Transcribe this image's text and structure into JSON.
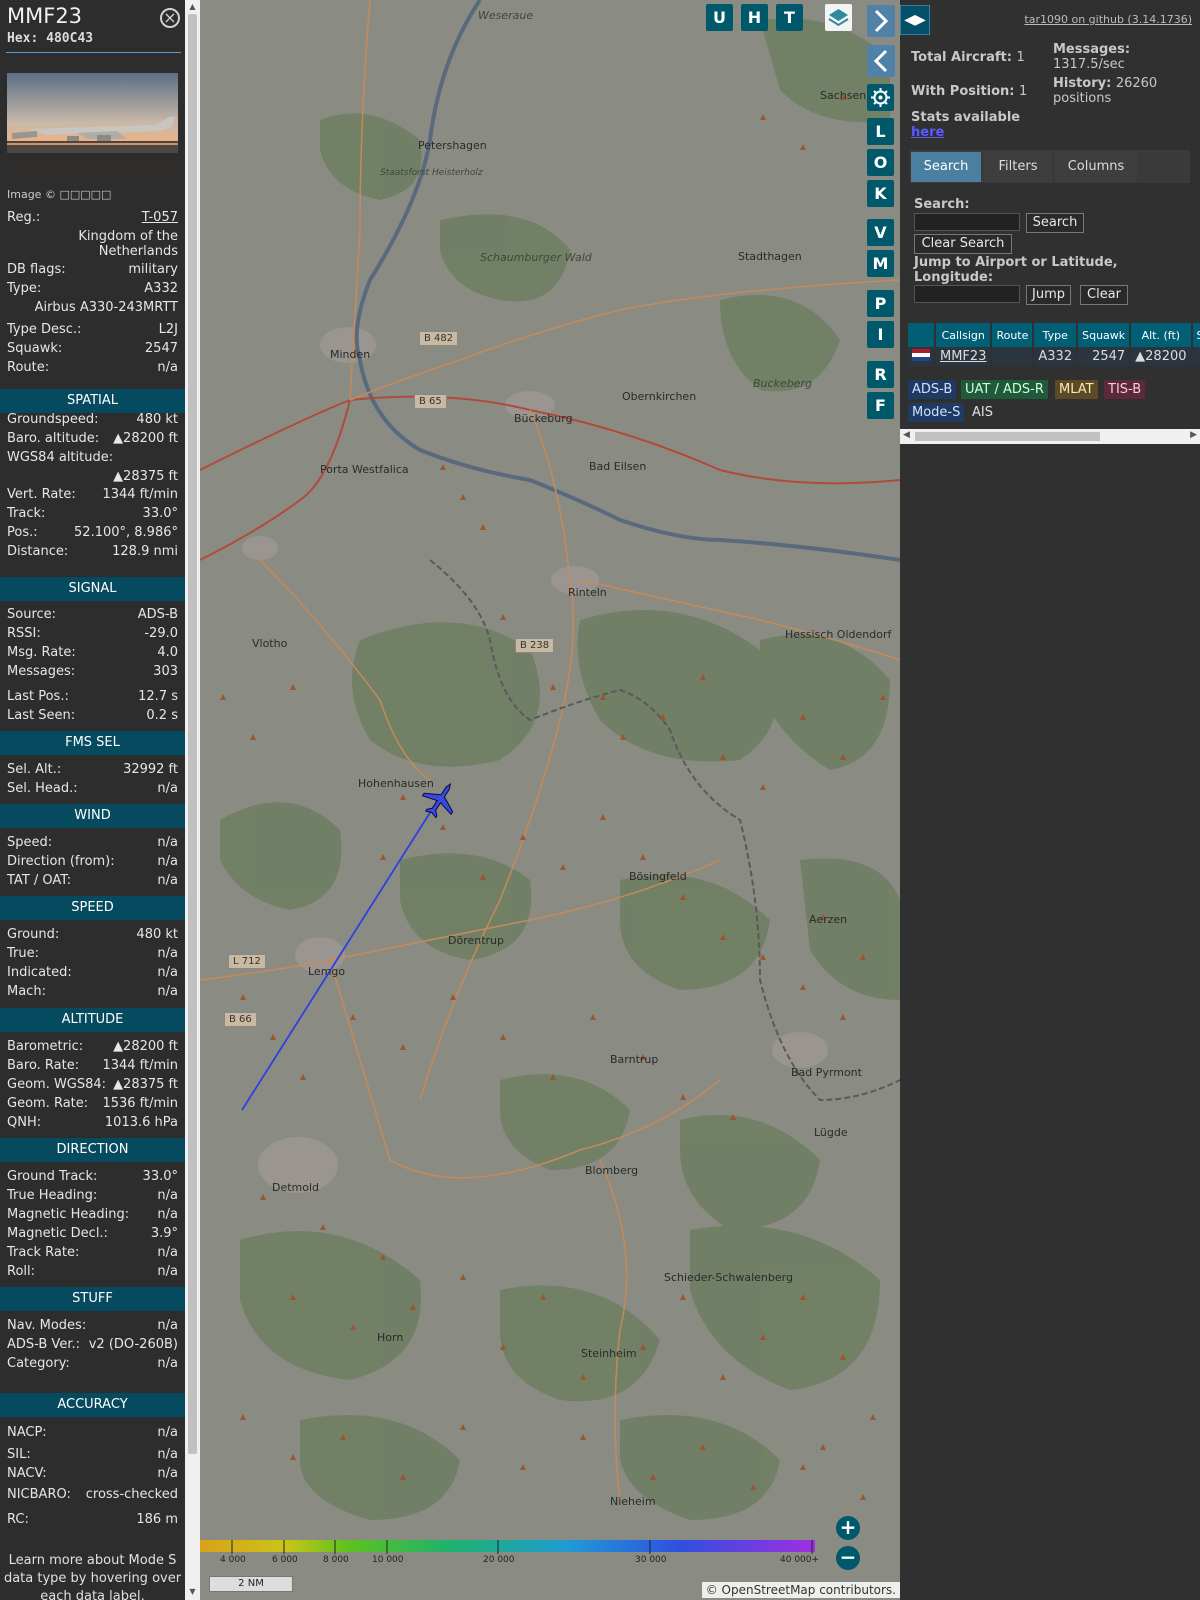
{
  "aircraft": {
    "callsign": "MMF23",
    "hex_label": "Hex:",
    "hex": "480C43",
    "photo_credit": "Image © □□□□□",
    "fields_top": [
      {
        "k": "Reg.:",
        "v": "T-057"
      },
      {
        "k": "DB flags:",
        "v": "military"
      },
      {
        "k": "Type:",
        "v": "A332"
      },
      {
        "k": "Type Desc.:",
        "v": "L2J"
      },
      {
        "k": "Squawk:",
        "v": "2547"
      },
      {
        "k": "Route:",
        "v": "n/a"
      }
    ],
    "country": "Kingdom of the Netherlands",
    "type_full": "Airbus A330-243MRTT"
  },
  "sections": {
    "spatial": {
      "title": "SPATIAL",
      "rows": [
        {
          "k": "Groundspeed:",
          "v": "480 kt"
        },
        {
          "k": "Baro. altitude:",
          "v": "▲28200 ft"
        },
        {
          "k": "WGS84 altitude:",
          "v": ""
        },
        {
          "k": "",
          "v": "▲28375 ft"
        },
        {
          "k": "Vert. Rate:",
          "v": "1344 ft/min"
        },
        {
          "k": "Track:",
          "v": "33.0°"
        },
        {
          "k": "Pos.:",
          "v": "52.100°, 8.986°"
        },
        {
          "k": "Distance:",
          "v": "128.9 nmi"
        }
      ]
    },
    "signal": {
      "title": "SIGNAL",
      "rows": [
        {
          "k": "Source:",
          "v": "ADS-B"
        },
        {
          "k": "RSSI:",
          "v": "-29.0"
        },
        {
          "k": "Msg. Rate:",
          "v": "4.0"
        },
        {
          "k": "Messages:",
          "v": "303"
        },
        {
          "k": "Last Pos.:",
          "v": "12.7 s"
        },
        {
          "k": "Last Seen:",
          "v": "0.2 s"
        }
      ]
    },
    "fms": {
      "title": "FMS SEL",
      "rows": [
        {
          "k": "Sel. Alt.:",
          "v": "32992 ft"
        },
        {
          "k": "Sel. Head.:",
          "v": "n/a"
        }
      ]
    },
    "wind": {
      "title": "WIND",
      "rows": [
        {
          "k": "Speed:",
          "v": "n/a"
        },
        {
          "k": "Direction (from):",
          "v": "n/a"
        },
        {
          "k": "TAT / OAT:",
          "v": "n/a"
        }
      ]
    },
    "speed": {
      "title": "SPEED",
      "rows": [
        {
          "k": "Ground:",
          "v": "480 kt"
        },
        {
          "k": "True:",
          "v": "n/a"
        },
        {
          "k": "Indicated:",
          "v": "n/a"
        },
        {
          "k": "Mach:",
          "v": "n/a"
        }
      ]
    },
    "altitude": {
      "title": "ALTITUDE",
      "rows": [
        {
          "k": "Barometric:",
          "v": "▲28200 ft"
        },
        {
          "k": "Baro. Rate:",
          "v": "1344 ft/min"
        },
        {
          "k": "Geom. WGS84:",
          "v": "▲28375 ft"
        },
        {
          "k": "Geom. Rate:",
          "v": "1536 ft/min"
        },
        {
          "k": "QNH:",
          "v": "1013.6 hPa"
        }
      ]
    },
    "direction": {
      "title": "DIRECTION",
      "rows": [
        {
          "k": "Ground Track:",
          "v": "33.0°"
        },
        {
          "k": "True Heading:",
          "v": "n/a"
        },
        {
          "k": "Magnetic Heading:",
          "v": "n/a"
        },
        {
          "k": "Magnetic Decl.:",
          "v": "3.9°"
        },
        {
          "k": "Track Rate:",
          "v": "n/a"
        },
        {
          "k": "Roll:",
          "v": "n/a"
        }
      ]
    },
    "stuff": {
      "title": "STUFF",
      "rows": [
        {
          "k": "Nav. Modes:",
          "v": "n/a"
        },
        {
          "k": "ADS-B Ver.:",
          "v": "v2 (DO-260B)"
        },
        {
          "k": "Category:",
          "v": "n/a"
        }
      ]
    },
    "accuracy": {
      "title": "ACCURACY",
      "rows": [
        {
          "k": "NACP:",
          "v": "n/a"
        },
        {
          "k": "SIL:",
          "v": "n/a"
        },
        {
          "k": "NACV:",
          "v": "n/a"
        },
        {
          "k": "NICBARO:",
          "v": "cross-checked"
        },
        {
          "k": "RC:",
          "v": "186 m"
        }
      ]
    }
  },
  "footer_note": "Learn more about Mode S data type by hovering over each data label.",
  "map": {
    "buttons": [
      "U",
      "H",
      "T",
      "L",
      "O",
      "K",
      "V",
      "M",
      "P",
      "I",
      "R",
      "F"
    ],
    "places": [
      "Weseraue",
      "Petershagen",
      "Staatsforst Heisterholz",
      "Sachsenh",
      "Schaumburger Wald",
      "Stadthagen",
      "Minden",
      "Obernkirchen",
      "Buckeberg",
      "Bückeburg",
      "Porta Westfalica",
      "Bad Eilsen",
      "Rinteln",
      "Vlotho",
      "Hessisch Oldendorf",
      "Hohenhausen",
      "Bösingfeld",
      "Dörentrup",
      "Aerzen",
      "Lemgo",
      "Barntrup",
      "Bad Pyrmont",
      "Lügde",
      "Blomberg",
      "Detmold",
      "Schieder-Schwalenberg",
      "Horn",
      "Steinheim",
      "Nieheim"
    ],
    "roads": [
      "B 482",
      "B 65",
      "B 238",
      "L 712",
      "B 66"
    ],
    "alt_scale": [
      "4 000",
      "6 000",
      "8 000",
      "10 000",
      "20 000",
      "30 000",
      "40 000+"
    ],
    "scale_label": "2 NM",
    "attribution": "© OpenStreetMap contributors.",
    "zoom_in": "+",
    "zoom_out": "−"
  },
  "right": {
    "version": "tar1090 on github (3.14.1736)",
    "total_aircraft_label": "Total Aircraft:",
    "total_aircraft": "1",
    "with_position_label": "With Position:",
    "with_position": "1",
    "messages_label": "Messages:",
    "messages": "1317.5/sec",
    "history_label": "History:",
    "history": "26260 positions",
    "stats_label": "Stats available",
    "stats_link": "here",
    "tabs": [
      "Search",
      "Filters",
      "Columns"
    ],
    "search_label": "Search:",
    "search_button": "Search",
    "clear_search_button": "Clear Search",
    "jump_label": "Jump to Airport or Latitude, Longitude:",
    "jump_button": "Jump",
    "clear_button": "Clear",
    "table_headers": [
      "",
      "Callsign",
      "Route",
      "Type",
      "Squawk",
      "Alt. (ft)",
      "Spd"
    ],
    "table_row": {
      "callsign": "MMF23",
      "route": "",
      "type": "A332",
      "squawk": "2547",
      "alt": "▲28200",
      "spd": ""
    },
    "sources": [
      "ADS-B",
      "UAT / ADS-R",
      "MLAT",
      "TIS-B",
      "Mode-S",
      "AIS"
    ],
    "source_colors": {
      "adsb": "#1f3a63",
      "uat": "#1f5a3a",
      "mlat": "#5a4a28",
      "tisb": "#5a2a3a",
      "modes": "#1f3a63",
      "ais": "#303030"
    }
  }
}
